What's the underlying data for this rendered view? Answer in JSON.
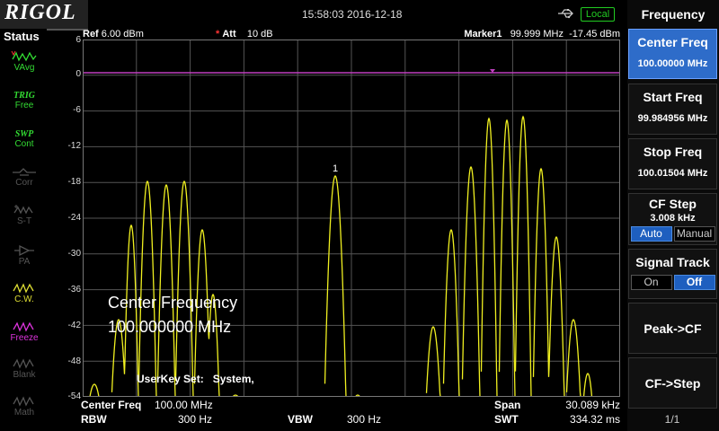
{
  "brand": "RIGOL",
  "datetime": "15:58:03 2016-12-18",
  "local_badge": "Local",
  "status": {
    "title": "Status",
    "items": [
      {
        "name": "vavg",
        "label": "VAvg",
        "color": "#33dd33"
      },
      {
        "name": "trig",
        "label": "TRIG",
        "sub": "Free",
        "color": "#33dd33"
      },
      {
        "name": "swp",
        "label": "SWP",
        "sub": "Cont",
        "color": "#33dd33"
      },
      {
        "name": "corr",
        "label": "Corr",
        "color": "#555555"
      },
      {
        "name": "st",
        "label": "S-T",
        "color": "#555555"
      },
      {
        "name": "pa",
        "label": "PA",
        "color": "#555555"
      },
      {
        "name": "cw",
        "label": "C.W.",
        "color": "#dddd33"
      },
      {
        "name": "freeze",
        "label": "Freeze",
        "color": "#dd33dd"
      },
      {
        "name": "blank",
        "label": "Blank",
        "color": "#555555"
      },
      {
        "name": "math",
        "label": "Math",
        "color": "#555555"
      }
    ]
  },
  "header": {
    "ref_label": "Ref",
    "ref_value": "6.00 dBm",
    "att_star": "*",
    "att_label": "Att",
    "att_value": "10 dB",
    "marker_label": "Marker1",
    "marker_freq": "99.999 MHz",
    "marker_level": "-17.45 dBm"
  },
  "y_labels": [
    "6",
    "0",
    "-6",
    "-12",
    "-18",
    "-24",
    "-30",
    "-36",
    "-42",
    "-48",
    "-54"
  ],
  "marker_number": "1",
  "overlay": {
    "line1": "Center Frequency",
    "line2": "100.000000 MHz",
    "userkey_label": "UserKey Set:",
    "userkey_value": "System,"
  },
  "bottom": {
    "cf_label": "Center Freq",
    "cf_value": "100.00 MHz",
    "span_label": "Span",
    "span_value": "30.089 kHz",
    "rbw_label": "RBW",
    "rbw_value": "300 Hz",
    "vbw_label": "VBW",
    "vbw_value": "300 Hz",
    "swt_label": "SWT",
    "swt_value": "334.32 ms"
  },
  "menu": {
    "title": "Frequency",
    "center_freq": {
      "label": "Center Freq",
      "value": "100.00000 MHz"
    },
    "start_freq": {
      "label": "Start Freq",
      "value": "99.984956 MHz"
    },
    "stop_freq": {
      "label": "Stop Freq",
      "value": "100.01504 MHz"
    },
    "cf_step": {
      "label": "CF Step",
      "value": "3.008 kHz",
      "opt_auto": "Auto",
      "opt_manual": "Manual"
    },
    "signal_track": {
      "label": "Signal Track",
      "opt_on": "On",
      "opt_off": "Off"
    },
    "peak_cf": "Peak->CF",
    "cf_step_key": "CF->Step",
    "page": "1/1"
  },
  "colors": {
    "trace": "#f0f020",
    "ref_line": "#c040c0",
    "grid": "#555555",
    "active_key": "#2e6cc9"
  }
}
